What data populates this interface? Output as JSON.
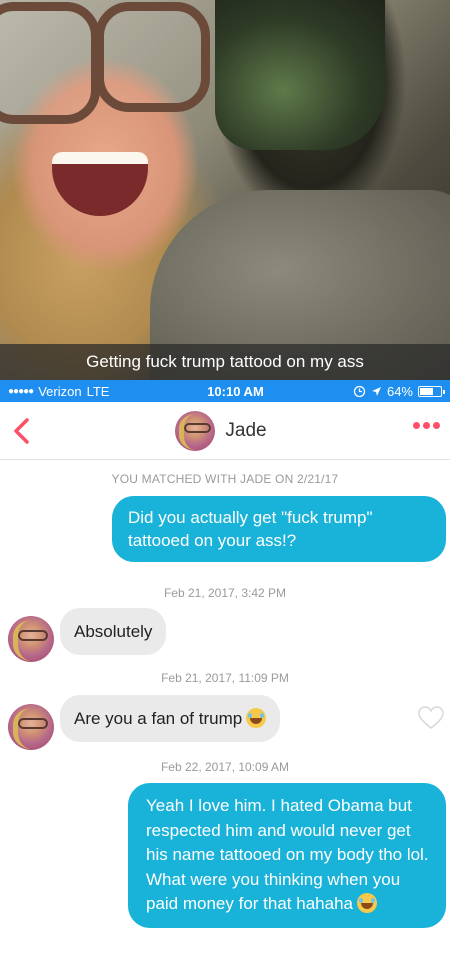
{
  "snap": {
    "caption": "Getting fuck trump tattood on my ass"
  },
  "status_bar": {
    "carrier": "Verizon",
    "network": "LTE",
    "time": "10:10 AM",
    "battery": "64%",
    "battery_level": 0.64,
    "icons": [
      "signal-dots-icon",
      "sync-icon",
      "location-arrow-icon",
      "battery-icon"
    ]
  },
  "header": {
    "name": "Jade",
    "icons": [
      "back-chevron-icon",
      "more-dots-icon"
    ],
    "accent": "#fd5068"
  },
  "conversation": {
    "matched_text": "YOU MATCHED WITH JADE ON 2/21/17",
    "messages": [
      {
        "from": "me",
        "text": "Did you actually get \"fuck trump\" tattooed on your ass!?"
      },
      {
        "timestamp": "Feb 21, 2017, 3:42 PM"
      },
      {
        "from": "jade",
        "text": "Absolutely"
      },
      {
        "timestamp": "Feb 21, 2017, 11:09 PM"
      },
      {
        "from": "jade",
        "text": "Are you a fan of trump",
        "emoji": "laughing-crying-emoji-icon"
      },
      {
        "timestamp": "Feb 22, 2017, 10:09 AM"
      },
      {
        "from": "me",
        "text": "Yeah I love him. I hated Obama but respected him and would never get his name tattooed on my body tho lol. What were you thinking when you paid money for that hahaha",
        "emoji": "laughing-crying-emoji-icon"
      }
    ],
    "colors": {
      "outgoing": "#19b2d8",
      "incoming": "#eaeaea"
    }
  }
}
